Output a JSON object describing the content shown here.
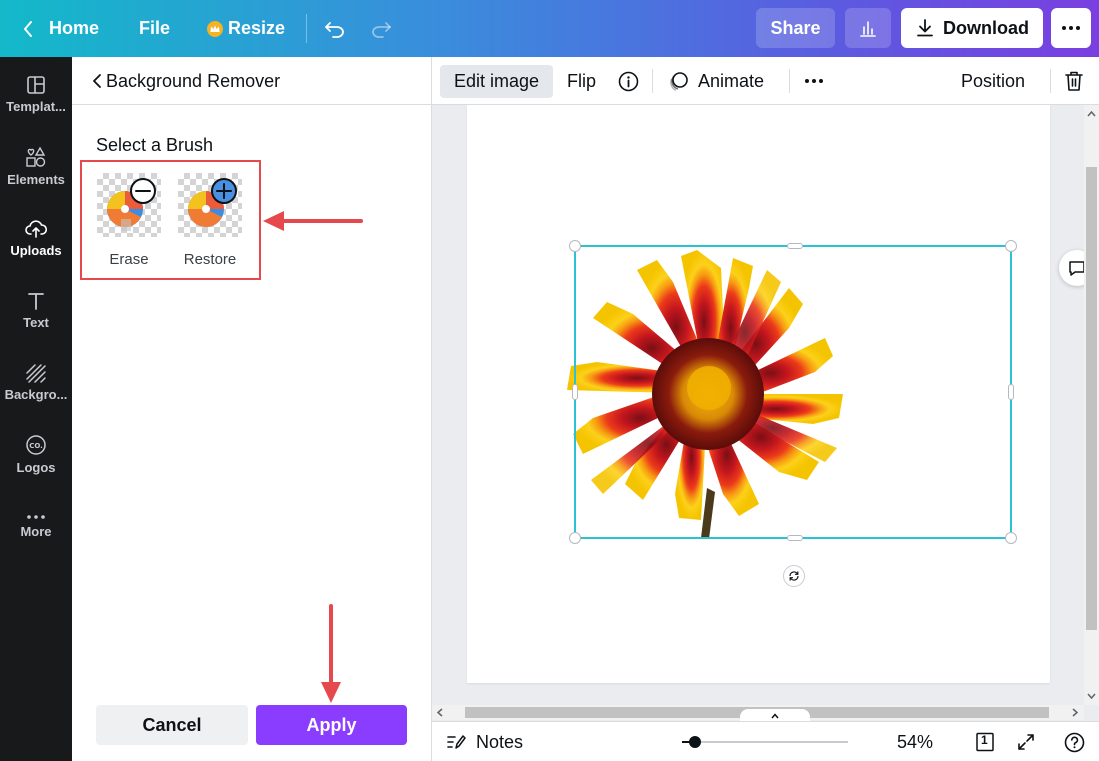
{
  "topbar": {
    "home_label": "Home",
    "file_label": "File",
    "resize_label": "Resize",
    "share_label": "Share",
    "download_label": "Download",
    "more_icon": "ellipsis-icon"
  },
  "rail": {
    "items": [
      {
        "label": "Templat...",
        "icon": "templates-icon"
      },
      {
        "label": "Elements",
        "icon": "elements-icon"
      },
      {
        "label": "Uploads",
        "icon": "uploads-icon"
      },
      {
        "label": "Text",
        "icon": "text-icon"
      },
      {
        "label": "Backgro...",
        "icon": "background-icon"
      },
      {
        "label": "Logos",
        "icon": "logos-icon"
      },
      {
        "label": "More",
        "icon": "more-icon"
      }
    ]
  },
  "panel": {
    "title": "Background Remover",
    "brush_heading": "Select a Brush",
    "brushes": [
      {
        "label": "Erase",
        "icon": "erase-brush-icon"
      },
      {
        "label": "Restore",
        "icon": "restore-brush-icon"
      }
    ],
    "cancel_label": "Cancel",
    "apply_label": "Apply"
  },
  "context_toolbar": {
    "edit_image_label": "Edit image",
    "flip_label": "Flip",
    "animate_label": "Animate",
    "position_label": "Position"
  },
  "bottombar": {
    "notes_label": "Notes",
    "zoom_label": "54%",
    "zoom_level": 0.08,
    "page_count": "1"
  },
  "colors": {
    "accent": "#8b3dff",
    "selection": "#2bc2d3",
    "annotation": "#e5484d"
  }
}
